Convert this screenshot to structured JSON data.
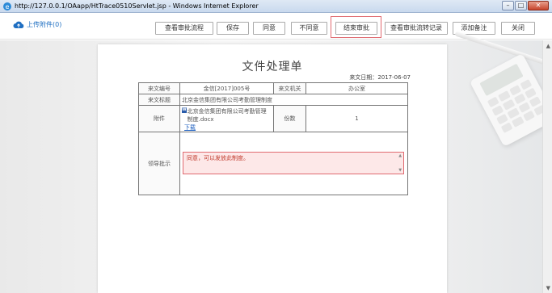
{
  "window": {
    "title": "http://127.0.0.1/OAapp/HtTrace0510Servlet.jsp - Windows Internet Explorer",
    "minimize": "–",
    "maximize": "□",
    "close": "✕"
  },
  "toolbar": {
    "attach_label": "上传附件(0)",
    "buttons": [
      {
        "label": "查看审批流程"
      },
      {
        "label": "保存"
      },
      {
        "label": "同意"
      },
      {
        "label": "不同意"
      },
      {
        "label": "结束审批"
      },
      {
        "label": "查看审批流转记录"
      },
      {
        "label": "添加备注"
      },
      {
        "label": "关闭"
      }
    ],
    "highlighted": "结束审批"
  },
  "document": {
    "title": "文件处理单",
    "date_label": "来文日期：",
    "date": "2017-06-07",
    "fields": {
      "doc_number_label": "来文编号",
      "doc_number": "金信[2017]005号",
      "issuer_label": "来文机关",
      "issuer": "办公室",
      "subject_label": "来文标题",
      "subject": "北京金信集团有限公司考勤管理制度",
      "attachment_label": "附件",
      "attachment_name": "北京金信集团有限公司考勤管理制度.docx",
      "download_label": "下载",
      "copies_label": "份数",
      "copies": "1",
      "instruction_label": "领导批示",
      "instruction_text": "同意，可以发放此制度。"
    }
  },
  "colors": {
    "highlight_border": "#e06a70",
    "link": "#1d5fbf",
    "opinion_bg": "#fde8e8",
    "opinion_text": "#c0392b"
  },
  "icons": {
    "attach": "cloud-upload-icon",
    "file": "word-document-icon"
  }
}
